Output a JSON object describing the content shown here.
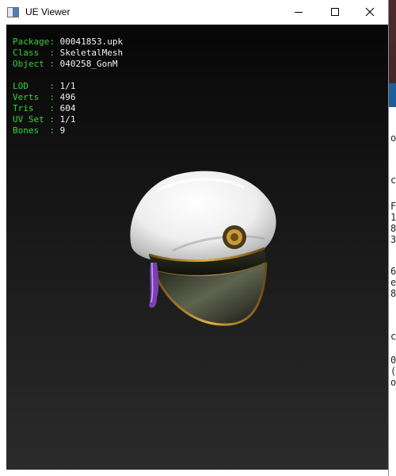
{
  "window": {
    "title": "UE Viewer"
  },
  "mesh_info": {
    "package": {
      "label": "Package:",
      "value": "00041853.upk"
    },
    "class": {
      "label": "Class  :",
      "value": "SkeletalMesh"
    },
    "object": {
      "label": "Object :",
      "value": "040258_GonM"
    },
    "lod": {
      "label": "LOD    :",
      "value": "1/1"
    },
    "verts": {
      "label": "Verts  :",
      "value": "496"
    },
    "tris": {
      "label": "Tris   :",
      "value": "604"
    },
    "uvset": {
      "label": "UV Set :",
      "value": "1/1"
    },
    "bones": {
      "label": "Bones  :",
      "value": "9"
    }
  },
  "background_window": {
    "fragments": [
      "o",
      "c",
      "F",
      "1",
      "8",
      "3",
      "6",
      "e",
      "8",
      "c",
      "0",
      "(",
      "o"
    ]
  },
  "colors": {
    "label": "#34d43a",
    "value": "#f2f2f2",
    "viewport_top": "#070707",
    "viewport_bottom": "#2b2b2b"
  },
  "icons": {
    "minimize": "minimize-icon",
    "maximize": "maximize-icon",
    "close": "close-icon",
    "app": "app-icon"
  }
}
